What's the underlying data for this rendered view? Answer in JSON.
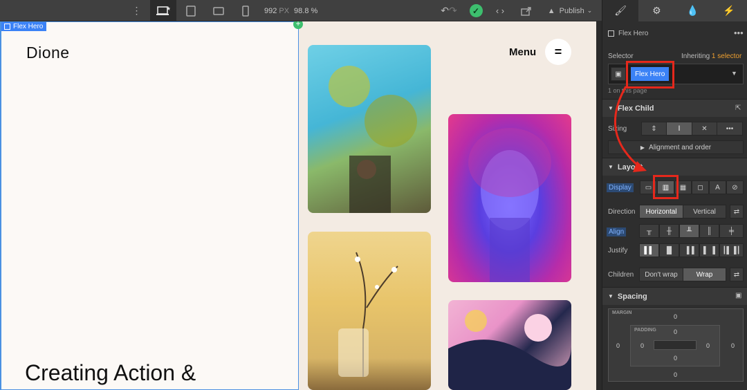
{
  "toolbar": {
    "more_icon": "more-icon",
    "devices": [
      "desktop-star-icon",
      "tablet-icon",
      "mobile-landscape-icon",
      "mobile-portrait-icon"
    ],
    "viewport_width": "992",
    "viewport_unit": "PX",
    "zoom": "98.8 %",
    "publish_label": "Publish"
  },
  "canvas": {
    "selected_tag": "Flex Hero",
    "logo": "Dione",
    "menu_label": "Menu",
    "menu_button": "=",
    "hero_heading": "Creating Action &"
  },
  "panel": {
    "element_name": "Flex Hero",
    "selector_label": "Selector",
    "inheriting_label": "Inheriting",
    "inheriting_count": "1 selector",
    "selector_chip": "Flex Hero",
    "on_page": "1 on this page",
    "flex_child_title": "Flex Child",
    "sizing_label": "Sizing",
    "alignment_order": "Alignment and order",
    "layout_title": "Layout",
    "display_label": "Display",
    "direction_label": "Direction",
    "direction_horizontal": "Horizontal",
    "direction_vertical": "Vertical",
    "align_label": "Align",
    "justify_label": "Justify",
    "children_label": "Children",
    "children_nowrap": "Don't wrap",
    "children_wrap": "Wrap",
    "spacing_title": "Spacing",
    "margin_label": "MARGIN",
    "padding_label": "PADDING",
    "margin": {
      "top": "0",
      "right": "0",
      "bottom": "0",
      "left": "0"
    },
    "padding": {
      "top": "0",
      "right": "0",
      "bottom": "0",
      "left": "0"
    }
  },
  "colors": {
    "accent": "#3b82f6",
    "highlight": "#e5281c",
    "success": "#3dbf6e"
  }
}
